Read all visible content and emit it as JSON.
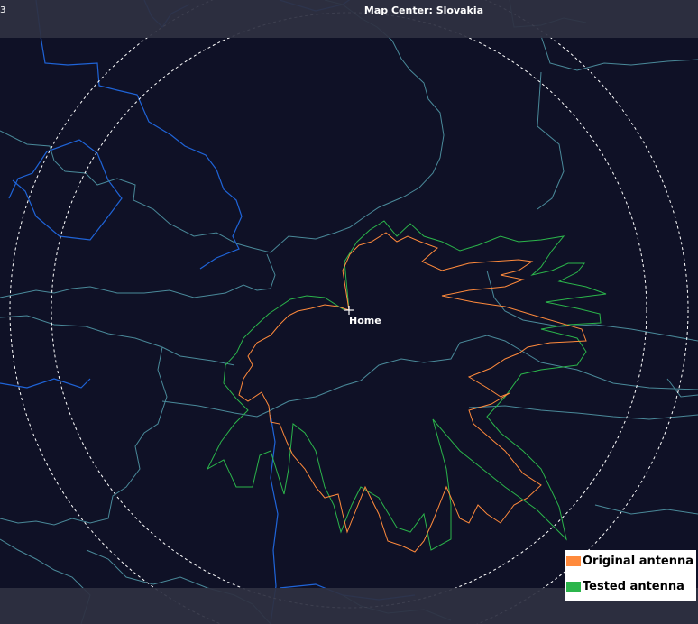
{
  "header": {
    "corner_label": "3",
    "title": "Map Center: Slovakia"
  },
  "map": {
    "home_label": "Home",
    "background_color": "#0f1126",
    "border_color": "#4a8a9a",
    "river_color": "#1f64d8",
    "range_ring_color": "#ffffff",
    "home_marker": "crosshair-icon"
  },
  "legend": {
    "items": [
      {
        "label": "Original antenna",
        "color": "#ff8a3c"
      },
      {
        "label": "Tested antenna",
        "color": "#2bb54b"
      }
    ]
  }
}
